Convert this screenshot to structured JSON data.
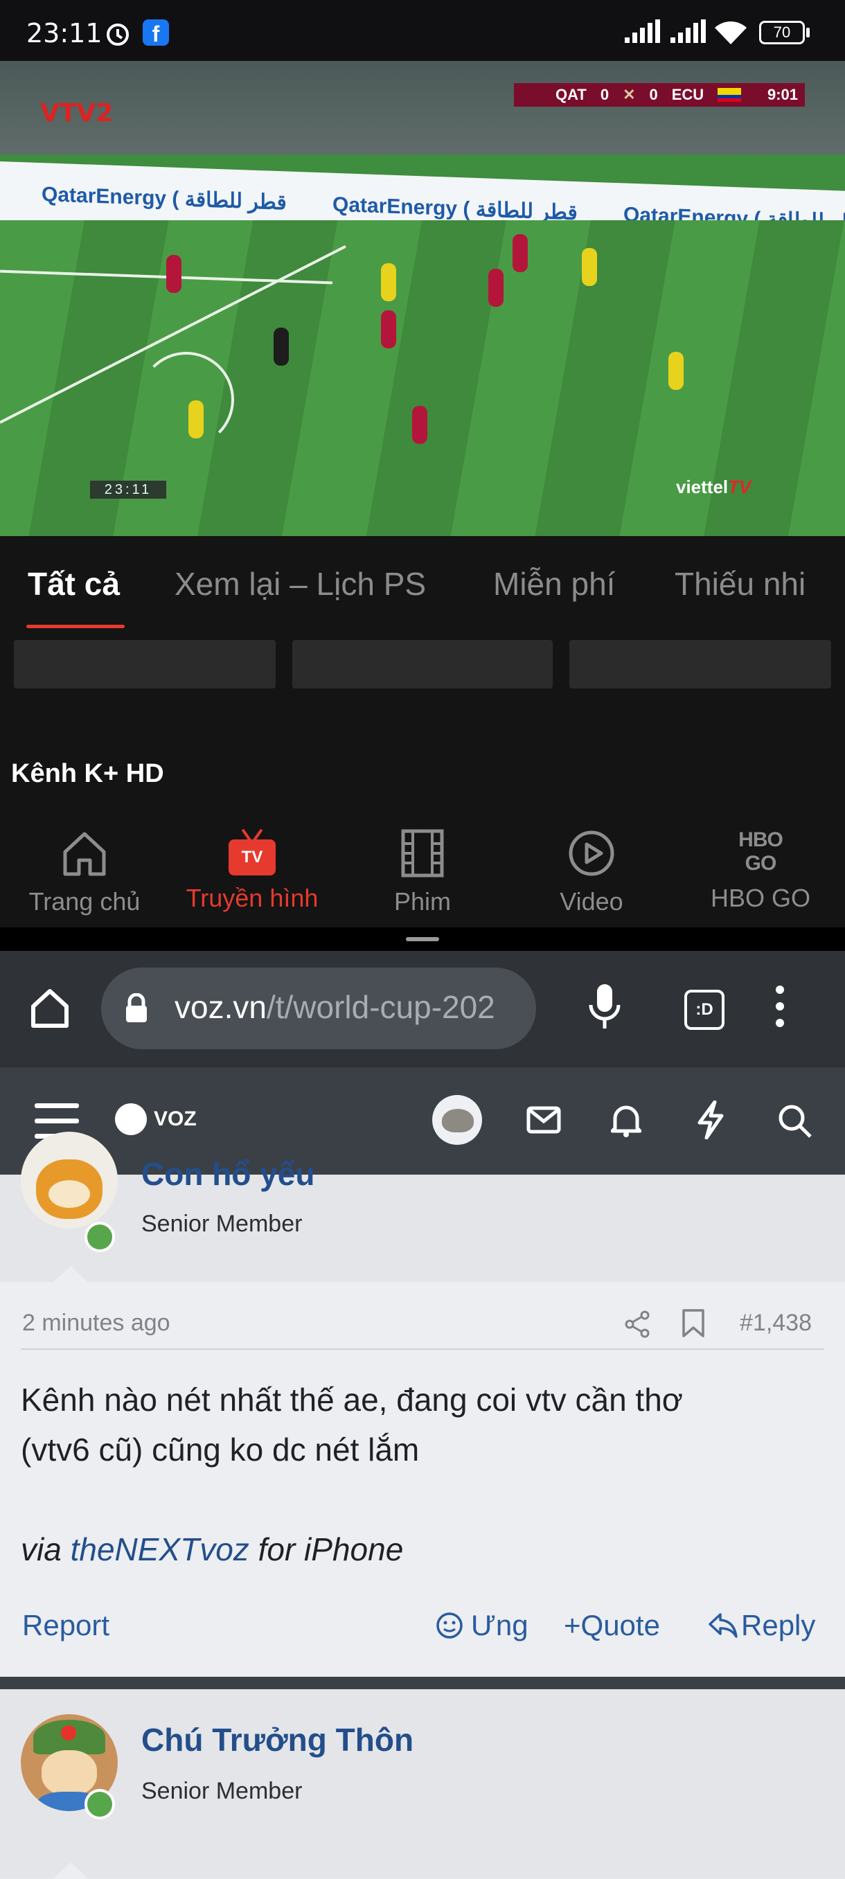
{
  "status_bar": {
    "time": "23:11",
    "battery": "70"
  },
  "video": {
    "score": {
      "home": "QAT",
      "home_score": "0",
      "away_score": "0",
      "away": "ECU",
      "clock": "9:01"
    },
    "channel_logo": "VTV2",
    "board_text": "QatarEnergy ( قطر للطاقة",
    "timestamp": "23:11",
    "watermark": "viettel",
    "watermark_suffix": "TV"
  },
  "tv_app": {
    "tabs": [
      {
        "label": "Tất cả",
        "active": true
      },
      {
        "label": "Xem lại – Lịch PS"
      },
      {
        "label": "Miễn phí"
      },
      {
        "label": "Thiếu nhi"
      }
    ],
    "section_title": "Kênh K+ HD",
    "bottom_nav": [
      {
        "label": "Trang chủ",
        "icon": "home-icon"
      },
      {
        "label": "Truyền hình",
        "icon": "tv-icon",
        "active": true,
        "badge": "TV"
      },
      {
        "label": "Phim",
        "icon": "film-icon"
      },
      {
        "label": "Video",
        "icon": "play-icon"
      },
      {
        "label": "HBO GO",
        "icon": "hbo-go-logo",
        "logo_text": "HBO GO"
      }
    ]
  },
  "browser": {
    "url_host": "voz.vn",
    "url_path": "/t/world-cup-202",
    "tab_badge": ":D"
  },
  "voz_header": {
    "logo_text": "VOZ"
  },
  "post1": {
    "author_name": "Con hổ yếu",
    "author_role": "Senior Member",
    "time": "2 minutes ago",
    "post_number": "#1,438",
    "body_line1": "Kênh nào nét nhất thế ae, đang coi vtv cần thơ",
    "body_line2": "(vtv6 cũ) cũng ko dc nét lắm",
    "via_prefix": "via ",
    "via_link": "theNEXTvoz",
    "via_suffix": " for iPhone",
    "actions": {
      "report": "Report",
      "ung": "Ưng",
      "quote": "Quote",
      "reply": "Reply"
    }
  },
  "post2": {
    "author_name": "Chú Trưởng Thôn",
    "author_role": "Senior Member"
  },
  "colors": {
    "accent_red": "#e63a2e",
    "voz_blue": "#234e8b",
    "online_green": "#58a64c",
    "score_bar": "#7a0d2b"
  }
}
